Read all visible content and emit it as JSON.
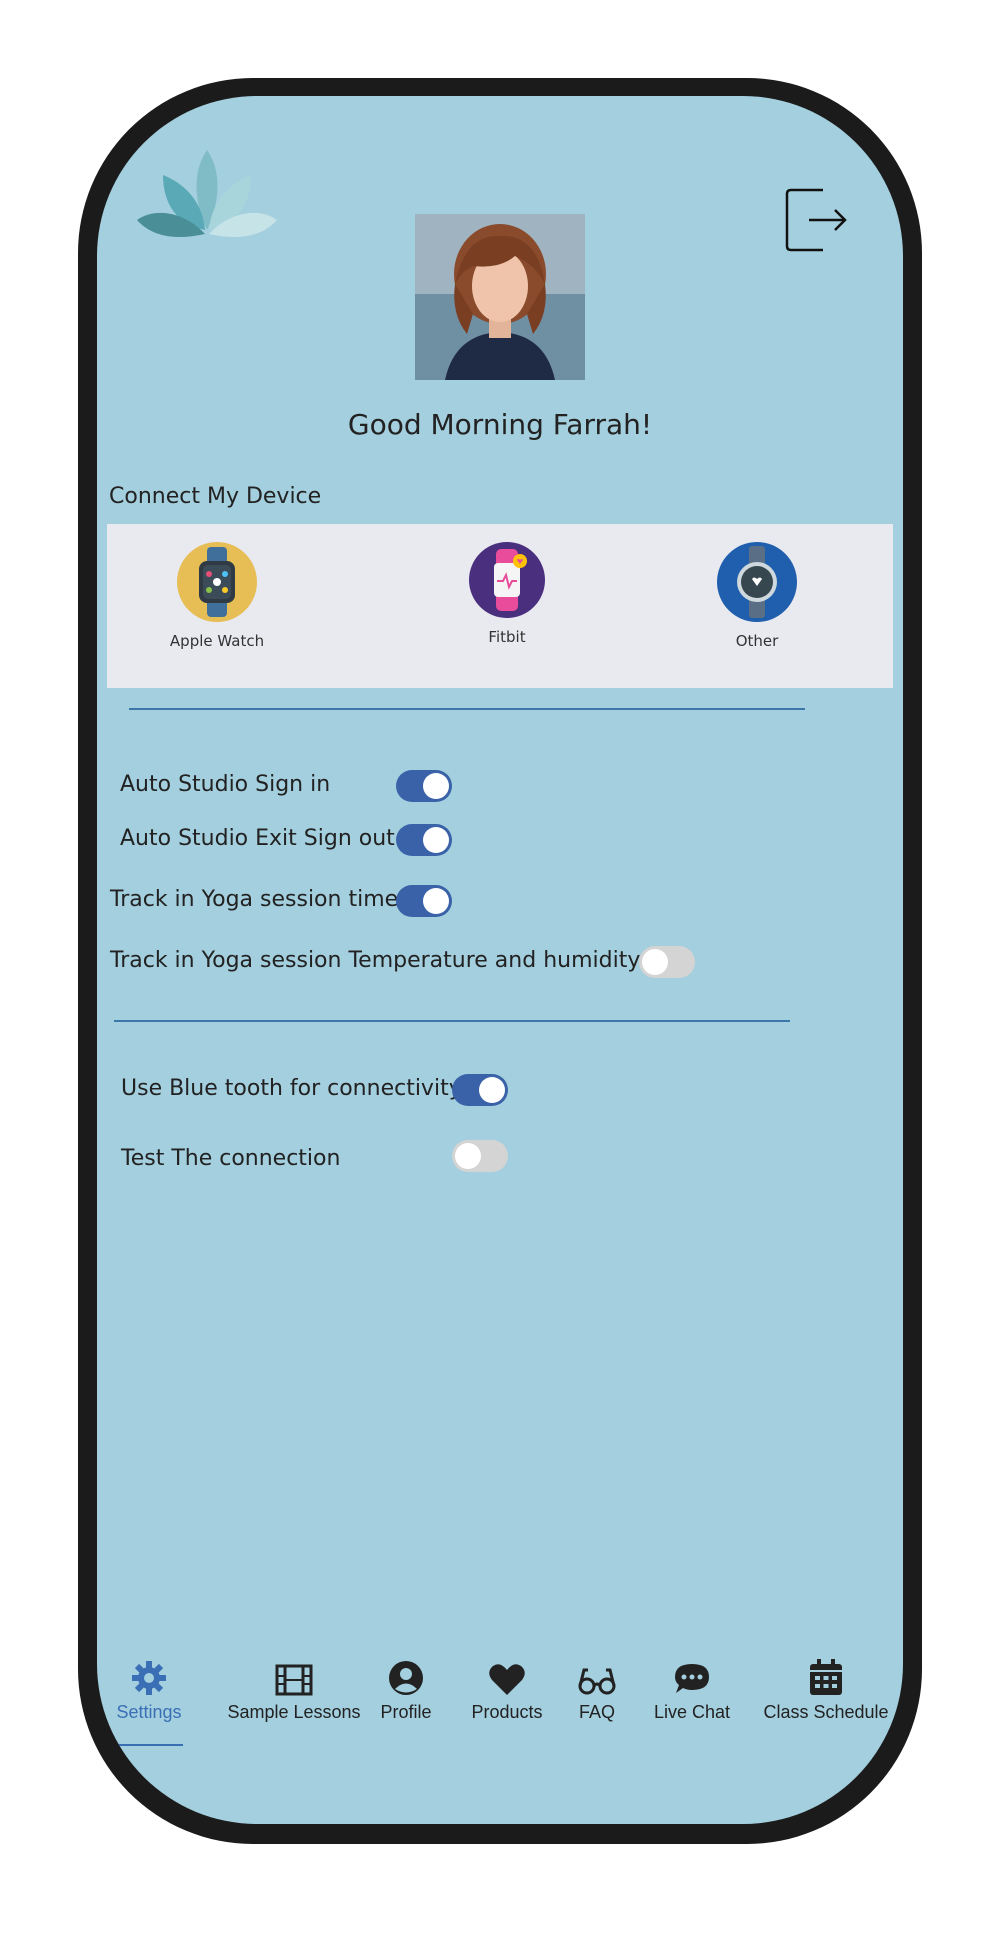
{
  "header": {
    "greeting": "Good Morning Farrah!",
    "logo_icon": "lotus-logo-icon",
    "exit_icon": "sign-out-icon"
  },
  "devices": {
    "label": "Connect My Device",
    "items": [
      {
        "label": "Apple Watch",
        "icon": "apple-watch-icon"
      },
      {
        "label": "Fitbit",
        "icon": "fitbit-icon"
      },
      {
        "label": "Other",
        "icon": "smartwatch-icon"
      }
    ]
  },
  "settings": {
    "group1": [
      {
        "label": "Auto Studio Sign in",
        "on": true
      },
      {
        "label": "Auto Studio Exit Sign out",
        "on": true
      },
      {
        "label": "Track in Yoga session time",
        "on": true
      },
      {
        "label": "Track in Yoga session Temperature and humidity",
        "on": false
      }
    ],
    "group2": [
      {
        "label": "Use Blue tooth for connectivity",
        "on": true
      },
      {
        "label": "Test The connection",
        "on": false
      }
    ]
  },
  "nav": {
    "items": [
      {
        "label": "Settings",
        "icon": "gear-icon",
        "active": true
      },
      {
        "label": "Sample Lessons",
        "icon": "film-icon",
        "active": false
      },
      {
        "label": "Profile",
        "icon": "user-icon",
        "active": false
      },
      {
        "label": "Products",
        "icon": "heart-icon",
        "active": false
      },
      {
        "label": "FAQ",
        "icon": "glasses-icon",
        "active": false
      },
      {
        "label": "Live Chat",
        "icon": "chat-icon",
        "active": false
      },
      {
        "label": "Class Schedule",
        "icon": "calendar-icon",
        "active": false
      }
    ]
  },
  "colors": {
    "screen_bg": "#a4cfdf",
    "accent": "#3a62a8",
    "active_nav": "#3b6fb5",
    "frame": "#1b1b1b"
  }
}
